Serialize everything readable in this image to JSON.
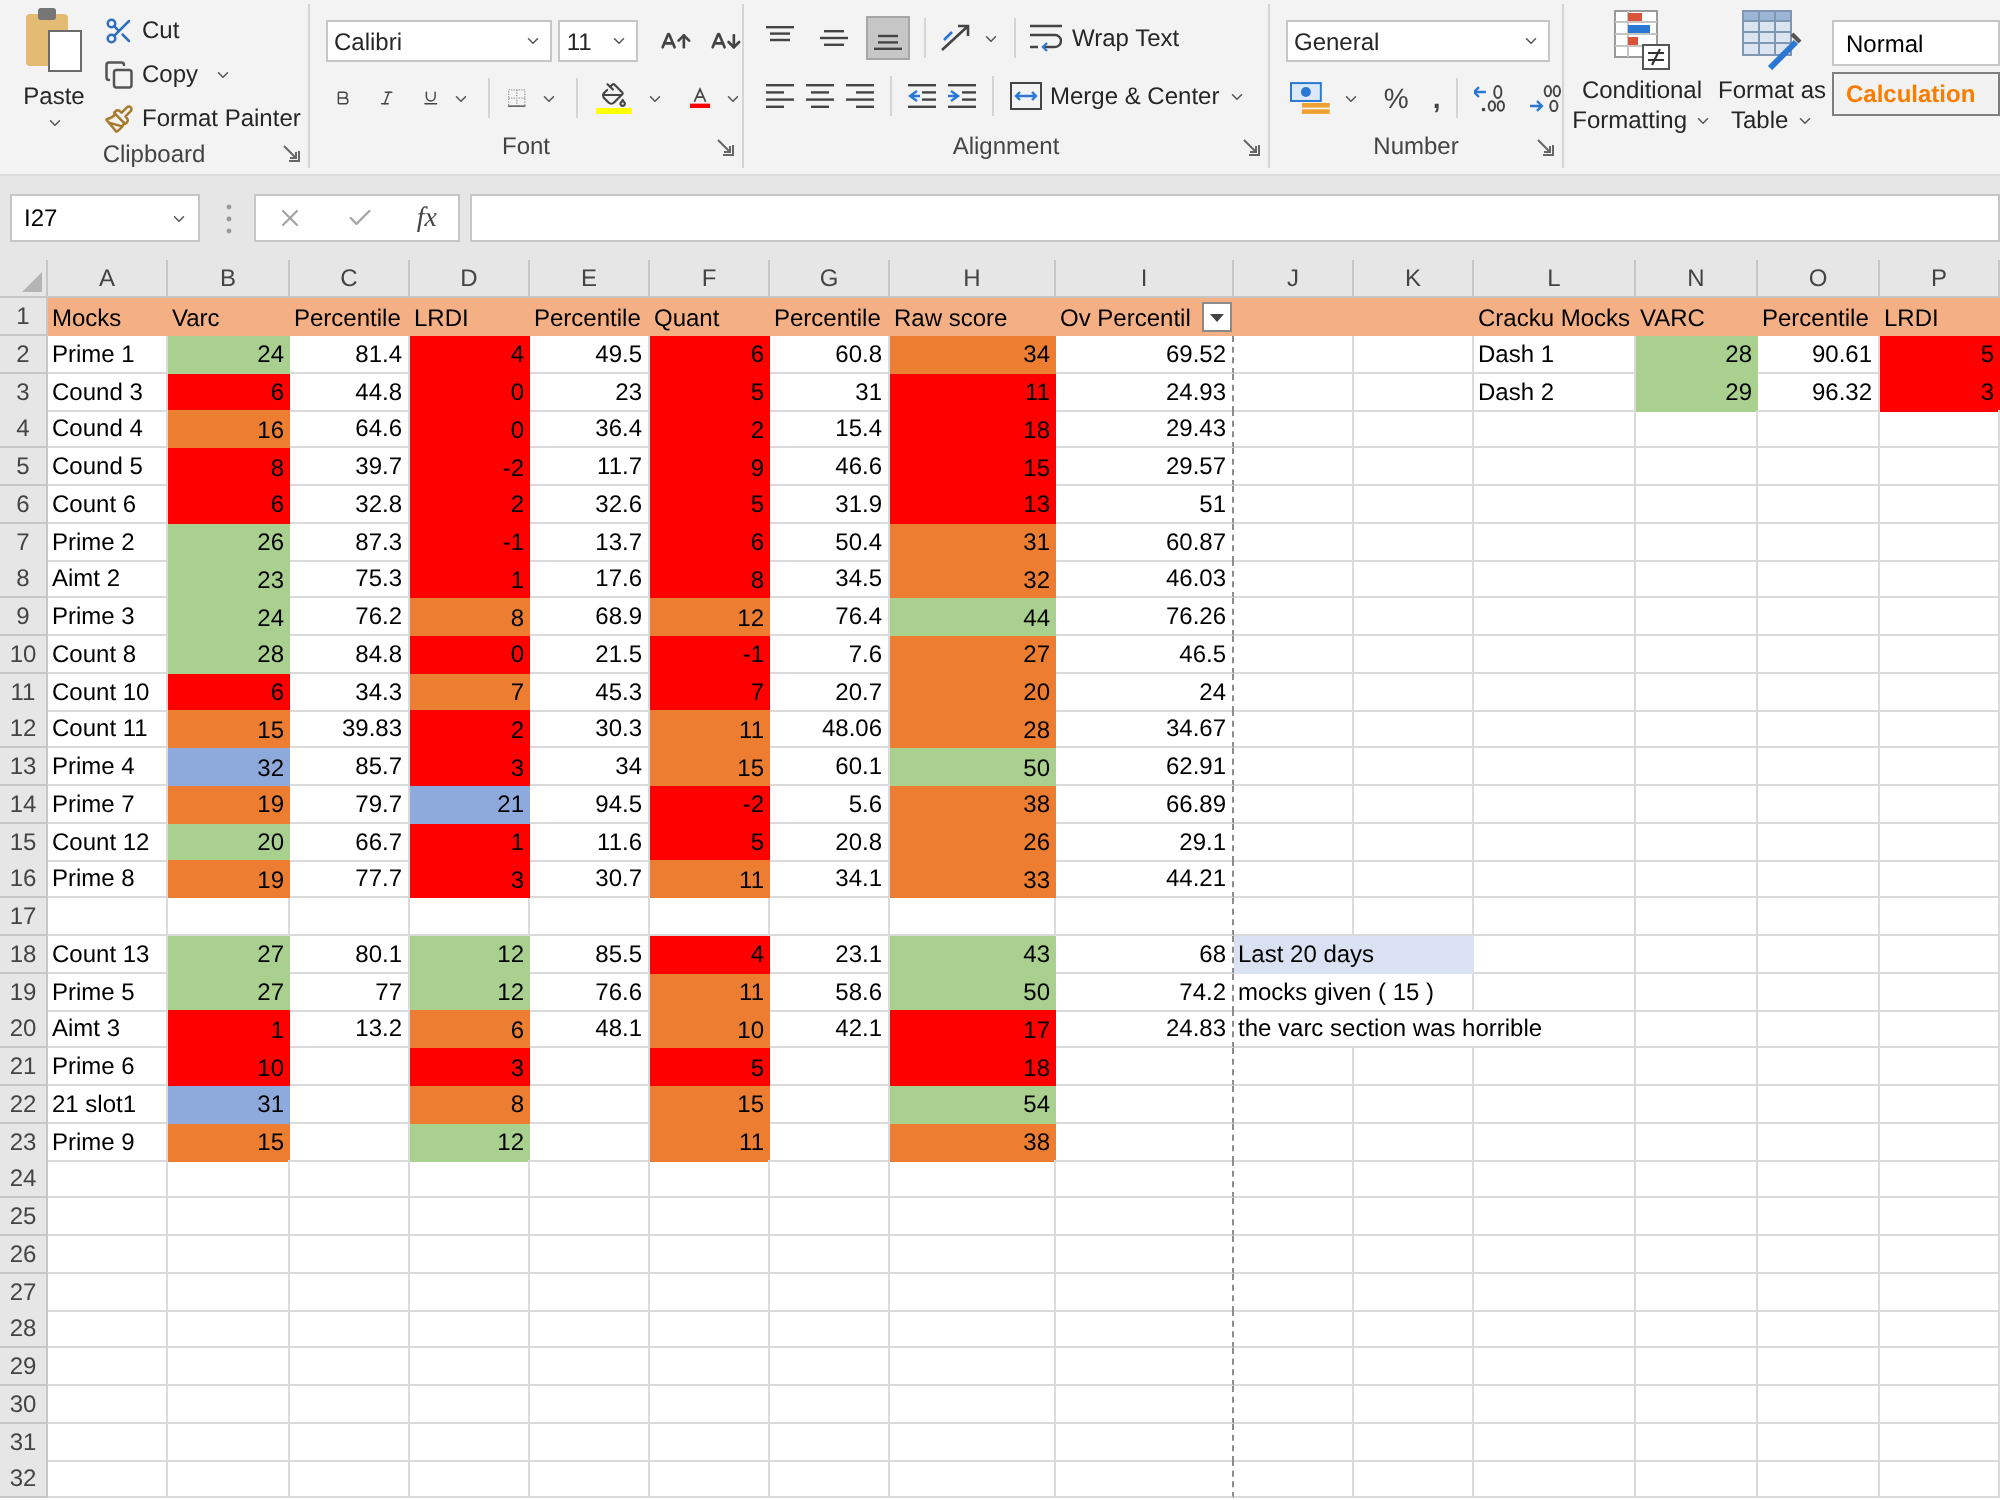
{
  "ribbon": {
    "clipboard": {
      "paste": "Paste",
      "cut": "Cut",
      "copy": "Copy",
      "format_painter": "Format Painter",
      "label": "Clipboard"
    },
    "font": {
      "font_name": "Calibri",
      "font_size": "11",
      "label": "Font"
    },
    "alignment": {
      "vertical": [
        {
          "kind": "top",
          "selected": false
        },
        {
          "kind": "middle",
          "selected": false
        },
        {
          "kind": "bottom",
          "selected": true
        }
      ],
      "wrap_text": "Wrap Text",
      "merge_center": "Merge & Center",
      "label": "Alignment"
    },
    "number": {
      "format": "General",
      "percent": "%",
      "comma": ",",
      "label": "Number"
    },
    "styles": {
      "conditional_formatting": "Conditional Formatting",
      "format_as_table": "Format as Table",
      "cell_styles": [
        {
          "kind": "normal",
          "label": "Normal"
        },
        {
          "kind": "calculation",
          "label": "Calculation"
        }
      ]
    }
  },
  "formula_bar": {
    "name_box": "I27",
    "function_label": "fx"
  },
  "sheet": {
    "columns": [
      "A",
      "B",
      "C",
      "D",
      "E",
      "F",
      "G",
      "H",
      "I",
      "J",
      "K",
      "L",
      "N",
      "O",
      "P"
    ],
    "rows": [
      {
        "number": "1",
        "cells": [
          {
            "text": "Mocks",
            "kind": "text",
            "color": "#f4b084"
          },
          {
            "text": "Varc",
            "kind": "text",
            "color": "#f4b084"
          },
          {
            "text": "Percentile",
            "kind": "text",
            "color": "#f4b084"
          },
          {
            "text": "LRDI",
            "kind": "text",
            "color": "#f4b084"
          },
          {
            "text": "Percentile",
            "kind": "text",
            "color": "#f4b084"
          },
          {
            "text": "Quant",
            "kind": "text",
            "color": "#f4b084"
          },
          {
            "text": "Percentile",
            "kind": "text",
            "color": "#f4b084"
          },
          {
            "text": "Raw score",
            "kind": "text",
            "color": "#f4b084"
          },
          {
            "text": "Ov Percentil",
            "kind": "text",
            "color": "#f4b084",
            "filter": true
          },
          {
            "color": "#f4b084"
          },
          {
            "color": "#f4b084"
          },
          {
            "text": "Cracku Mocks",
            "kind": "text",
            "color": "#f4b084"
          },
          {
            "text": "VARC",
            "kind": "text",
            "color": "#f4b084"
          },
          {
            "text": "Percentile",
            "kind": "text",
            "color": "#f4b084"
          },
          {
            "text": "LRDI",
            "kind": "text",
            "color": "#f4b084"
          }
        ]
      },
      {
        "number": "2",
        "cells": [
          {
            "text": "Prime 1",
            "kind": "text"
          },
          {
            "text": "24",
            "kind": "number",
            "color": "#a9d08e"
          },
          {
            "text": "81.4",
            "kind": "number"
          },
          {
            "text": "4",
            "kind": "number",
            "color": "#ff0000"
          },
          {
            "text": "49.5",
            "kind": "number"
          },
          {
            "text": "6",
            "kind": "number",
            "color": "#ff0000"
          },
          {
            "text": "60.8",
            "kind": "number"
          },
          {
            "text": "34",
            "kind": "number",
            "color": "#ed7d31"
          },
          {
            "text": "69.52",
            "kind": "number"
          },
          null,
          null,
          {
            "text": "Dash 1",
            "kind": "text"
          },
          {
            "text": "28",
            "kind": "number",
            "color": "#a9d08e"
          },
          {
            "text": "90.61",
            "kind": "number"
          },
          {
            "text": "5",
            "kind": "number",
            "color": "#ff0000"
          }
        ]
      },
      {
        "number": "3",
        "cells": [
          {
            "text": "Cound 3",
            "kind": "text"
          },
          {
            "text": "6",
            "kind": "number",
            "color": "#ff0000"
          },
          {
            "text": "44.8",
            "kind": "number"
          },
          {
            "text": "0",
            "kind": "number",
            "color": "#ff0000"
          },
          {
            "text": "23",
            "kind": "number"
          },
          {
            "text": "5",
            "kind": "number",
            "color": "#ff0000"
          },
          {
            "text": "31",
            "kind": "number"
          },
          {
            "text": "11",
            "kind": "number",
            "color": "#ff0000"
          },
          {
            "text": "24.93",
            "kind": "number"
          },
          null,
          null,
          {
            "text": "Dash 2",
            "kind": "text"
          },
          {
            "text": "29",
            "kind": "number",
            "color": "#a9d08e"
          },
          {
            "text": "96.32",
            "kind": "number"
          },
          {
            "text": "3",
            "kind": "number",
            "color": "#ff0000"
          }
        ]
      },
      {
        "number": "4",
        "cells": [
          {
            "text": "Cound 4",
            "kind": "text"
          },
          {
            "text": "16",
            "kind": "number",
            "color": "#ed7d31"
          },
          {
            "text": "64.6",
            "kind": "number"
          },
          {
            "text": "0",
            "kind": "number",
            "color": "#ff0000"
          },
          {
            "text": "36.4",
            "kind": "number"
          },
          {
            "text": "2",
            "kind": "number",
            "color": "#ff0000"
          },
          {
            "text": "15.4",
            "kind": "number"
          },
          {
            "text": "18",
            "kind": "number",
            "color": "#ff0000"
          },
          {
            "text": "29.43",
            "kind": "number"
          }
        ]
      },
      {
        "number": "5",
        "cells": [
          {
            "text": "Cound 5",
            "kind": "text"
          },
          {
            "text": "8",
            "kind": "number",
            "color": "#ff0000"
          },
          {
            "text": "39.7",
            "kind": "number"
          },
          {
            "text": "-2",
            "kind": "number",
            "color": "#ff0000"
          },
          {
            "text": "11.7",
            "kind": "number"
          },
          {
            "text": "9",
            "kind": "number",
            "color": "#ff0000"
          },
          {
            "text": "46.6",
            "kind": "number"
          },
          {
            "text": "15",
            "kind": "number",
            "color": "#ff0000"
          },
          {
            "text": "29.57",
            "kind": "number"
          }
        ]
      },
      {
        "number": "6",
        "cells": [
          {
            "text": "Count 6",
            "kind": "text"
          },
          {
            "text": "6",
            "kind": "number",
            "color": "#ff0000"
          },
          {
            "text": "32.8",
            "kind": "number"
          },
          {
            "text": "2",
            "kind": "number",
            "color": "#ff0000"
          },
          {
            "text": "32.6",
            "kind": "number"
          },
          {
            "text": "5",
            "kind": "number",
            "color": "#ff0000"
          },
          {
            "text": "31.9",
            "kind": "number"
          },
          {
            "text": "13",
            "kind": "number",
            "color": "#ff0000"
          },
          {
            "text": "51",
            "kind": "number"
          }
        ]
      },
      {
        "number": "7",
        "cells": [
          {
            "text": "Prime 2",
            "kind": "text"
          },
          {
            "text": "26",
            "kind": "number",
            "color": "#a9d08e"
          },
          {
            "text": "87.3",
            "kind": "number"
          },
          {
            "text": "-1",
            "kind": "number",
            "color": "#ff0000"
          },
          {
            "text": "13.7",
            "kind": "number"
          },
          {
            "text": "6",
            "kind": "number",
            "color": "#ff0000"
          },
          {
            "text": "50.4",
            "kind": "number"
          },
          {
            "text": "31",
            "kind": "number",
            "color": "#ed7d31"
          },
          {
            "text": "60.87",
            "kind": "number"
          }
        ]
      },
      {
        "number": "8",
        "cells": [
          {
            "text": "Aimt 2",
            "kind": "text"
          },
          {
            "text": "23",
            "kind": "number",
            "color": "#a9d08e"
          },
          {
            "text": "75.3",
            "kind": "number"
          },
          {
            "text": "1",
            "kind": "number",
            "color": "#ff0000"
          },
          {
            "text": "17.6",
            "kind": "number"
          },
          {
            "text": "8",
            "kind": "number",
            "color": "#ff0000"
          },
          {
            "text": "34.5",
            "kind": "number"
          },
          {
            "text": "32",
            "kind": "number",
            "color": "#ed7d31"
          },
          {
            "text": "46.03",
            "kind": "number"
          }
        ]
      },
      {
        "number": "9",
        "cells": [
          {
            "text": "Prime 3",
            "kind": "text"
          },
          {
            "text": "24",
            "kind": "number",
            "color": "#a9d08e"
          },
          {
            "text": "76.2",
            "kind": "number"
          },
          {
            "text": "8",
            "kind": "number",
            "color": "#ed7d31"
          },
          {
            "text": "68.9",
            "kind": "number"
          },
          {
            "text": "12",
            "kind": "number",
            "color": "#ed7d31"
          },
          {
            "text": "76.4",
            "kind": "number"
          },
          {
            "text": "44",
            "kind": "number",
            "color": "#a9d08e"
          },
          {
            "text": "76.26",
            "kind": "number"
          }
        ]
      },
      {
        "number": "10",
        "cells": [
          {
            "text": "Count 8",
            "kind": "text"
          },
          {
            "text": "28",
            "kind": "number",
            "color": "#a9d08e"
          },
          {
            "text": "84.8",
            "kind": "number"
          },
          {
            "text": "0",
            "kind": "number",
            "color": "#ff0000"
          },
          {
            "text": "21.5",
            "kind": "number"
          },
          {
            "text": "-1",
            "kind": "number",
            "color": "#ff0000"
          },
          {
            "text": "7.6",
            "kind": "number"
          },
          {
            "text": "27",
            "kind": "number",
            "color": "#ed7d31"
          },
          {
            "text": "46.5",
            "kind": "number"
          }
        ]
      },
      {
        "number": "11",
        "cells": [
          {
            "text": "Count 10",
            "kind": "text"
          },
          {
            "text": "6",
            "kind": "number",
            "color": "#ff0000"
          },
          {
            "text": "34.3",
            "kind": "number"
          },
          {
            "text": "7",
            "kind": "number",
            "color": "#ed7d31"
          },
          {
            "text": "45.3",
            "kind": "number"
          },
          {
            "text": "7",
            "kind": "number",
            "color": "#ff0000"
          },
          {
            "text": "20.7",
            "kind": "number"
          },
          {
            "text": "20",
            "kind": "number",
            "color": "#ed7d31"
          },
          {
            "text": "24",
            "kind": "number"
          }
        ]
      },
      {
        "number": "12",
        "cells": [
          {
            "text": "Count 11",
            "kind": "text"
          },
          {
            "text": "15",
            "kind": "number",
            "color": "#ed7d31"
          },
          {
            "text": "39.83",
            "kind": "number"
          },
          {
            "text": "2",
            "kind": "number",
            "color": "#ff0000"
          },
          {
            "text": "30.3",
            "kind": "number"
          },
          {
            "text": "11",
            "kind": "number",
            "color": "#ed7d31"
          },
          {
            "text": "48.06",
            "kind": "number"
          },
          {
            "text": "28",
            "kind": "number",
            "color": "#ed7d31"
          },
          {
            "text": "34.67",
            "kind": "number"
          }
        ]
      },
      {
        "number": "13",
        "cells": [
          {
            "text": "Prime 4",
            "kind": "text"
          },
          {
            "text": "32",
            "kind": "number",
            "color": "#8ea9db"
          },
          {
            "text": "85.7",
            "kind": "number"
          },
          {
            "text": "3",
            "kind": "number",
            "color": "#ff0000"
          },
          {
            "text": "34",
            "kind": "number"
          },
          {
            "text": "15",
            "kind": "number",
            "color": "#ed7d31"
          },
          {
            "text": "60.1",
            "kind": "number"
          },
          {
            "text": "50",
            "kind": "number",
            "color": "#a9d08e"
          },
          {
            "text": "62.91",
            "kind": "number"
          }
        ]
      },
      {
        "number": "14",
        "cells": [
          {
            "text": "Prime 7",
            "kind": "text"
          },
          {
            "text": "19",
            "kind": "number",
            "color": "#ed7d31"
          },
          {
            "text": "79.7",
            "kind": "number"
          },
          {
            "text": "21",
            "kind": "number",
            "color": "#8ea9db"
          },
          {
            "text": "94.5",
            "kind": "number"
          },
          {
            "text": "-2",
            "kind": "number",
            "color": "#ff0000"
          },
          {
            "text": "5.6",
            "kind": "number"
          },
          {
            "text": "38",
            "kind": "number",
            "color": "#ed7d31"
          },
          {
            "text": "66.89",
            "kind": "number"
          }
        ]
      },
      {
        "number": "15",
        "cells": [
          {
            "text": "Count 12",
            "kind": "text"
          },
          {
            "text": "20",
            "kind": "number",
            "color": "#a9d08e"
          },
          {
            "text": "66.7",
            "kind": "number"
          },
          {
            "text": "1",
            "kind": "number",
            "color": "#ff0000"
          },
          {
            "text": "11.6",
            "kind": "number"
          },
          {
            "text": "5",
            "kind": "number",
            "color": "#ff0000"
          },
          {
            "text": "20.8",
            "kind": "number"
          },
          {
            "text": "26",
            "kind": "number",
            "color": "#ed7d31"
          },
          {
            "text": "29.1",
            "kind": "number"
          }
        ]
      },
      {
        "number": "16",
        "cells": [
          {
            "text": "Prime 8",
            "kind": "text"
          },
          {
            "text": "19",
            "kind": "number",
            "color": "#ed7d31"
          },
          {
            "text": "77.7",
            "kind": "number"
          },
          {
            "text": "3",
            "kind": "number",
            "color": "#ff0000"
          },
          {
            "text": "30.7",
            "kind": "number"
          },
          {
            "text": "11",
            "kind": "number",
            "color": "#ed7d31"
          },
          {
            "text": "34.1",
            "kind": "number"
          },
          {
            "text": "33",
            "kind": "number",
            "color": "#ed7d31"
          },
          {
            "text": "44.21",
            "kind": "number"
          }
        ]
      },
      {
        "number": "17"
      },
      {
        "number": "18",
        "cells": [
          {
            "text": "Count 13",
            "kind": "text"
          },
          {
            "text": "27",
            "kind": "number",
            "color": "#a9d08e"
          },
          {
            "text": "80.1",
            "kind": "number"
          },
          {
            "text": "12",
            "kind": "number",
            "color": "#a9d08e"
          },
          {
            "text": "85.5",
            "kind": "number"
          },
          {
            "text": "4",
            "kind": "number",
            "color": "#ff0000"
          },
          {
            "text": "23.1",
            "kind": "number"
          },
          {
            "text": "43",
            "kind": "number",
            "color": "#a9d08e"
          },
          {
            "text": "68",
            "kind": "number"
          },
          {
            "text": "Last 20 days",
            "kind": "text",
            "color": "#d9e1f2"
          }
        ]
      },
      {
        "number": "19",
        "cells": [
          {
            "text": "Prime 5",
            "kind": "text"
          },
          {
            "text": "27",
            "kind": "number",
            "color": "#a9d08e"
          },
          {
            "text": "77",
            "kind": "number"
          },
          {
            "text": "12",
            "kind": "number",
            "color": "#a9d08e"
          },
          {
            "text": "76.6",
            "kind": "number"
          },
          {
            "text": "11",
            "kind": "number",
            "color": "#ed7d31"
          },
          {
            "text": "58.6",
            "kind": "number"
          },
          {
            "text": "50",
            "kind": "number",
            "color": "#a9d08e"
          },
          {
            "text": "74.2",
            "kind": "number"
          },
          {
            "text": "mocks given ( 15 )",
            "kind": "text"
          }
        ]
      },
      {
        "number": "20",
        "cells": [
          {
            "text": "Aimt 3",
            "kind": "text"
          },
          {
            "text": "1",
            "kind": "number",
            "color": "#ff0000"
          },
          {
            "text": "13.2",
            "kind": "number"
          },
          {
            "text": "6",
            "kind": "number",
            "color": "#ed7d31"
          },
          {
            "text": "48.1",
            "kind": "number"
          },
          {
            "text": "10",
            "kind": "number",
            "color": "#ed7d31"
          },
          {
            "text": "42.1",
            "kind": "number"
          },
          {
            "text": "17",
            "kind": "number",
            "color": "#ff0000"
          },
          {
            "text": "24.83",
            "kind": "number"
          },
          {
            "text": "the varc section was horrible",
            "kind": "text"
          }
        ]
      },
      {
        "number": "21",
        "cells": [
          {
            "text": "Prime 6",
            "kind": "text"
          },
          {
            "text": "10",
            "kind": "number",
            "color": "#ff0000"
          },
          null,
          {
            "text": "3",
            "kind": "number",
            "color": "#ff0000"
          },
          null,
          {
            "text": "5",
            "kind": "number",
            "color": "#ff0000"
          },
          null,
          {
            "text": "18",
            "kind": "number",
            "color": "#ff0000"
          }
        ]
      },
      {
        "number": "22",
        "cells": [
          {
            "text": "21 slot1",
            "kind": "text"
          },
          {
            "text": "31",
            "kind": "number",
            "color": "#8ea9db"
          },
          null,
          {
            "text": "8",
            "kind": "number",
            "color": "#ed7d31"
          },
          null,
          {
            "text": "15",
            "kind": "number",
            "color": "#ed7d31"
          },
          null,
          {
            "text": "54",
            "kind": "number",
            "color": "#a9d08e"
          }
        ]
      },
      {
        "number": "23",
        "cells": [
          {
            "text": "Prime 9",
            "kind": "text"
          },
          {
            "text": "15",
            "kind": "number",
            "color": "#ed7d31"
          },
          null,
          {
            "text": "12",
            "kind": "number",
            "color": "#a9d08e"
          },
          null,
          {
            "text": "11",
            "kind": "number",
            "color": "#ed7d31"
          },
          null,
          {
            "text": "38",
            "kind": "number",
            "color": "#ed7d31"
          }
        ]
      },
      {
        "number": "24"
      },
      {
        "number": "25"
      },
      {
        "number": "26"
      },
      {
        "number": "27"
      },
      {
        "number": "28"
      },
      {
        "number": "29"
      },
      {
        "number": "30"
      },
      {
        "number": "31"
      },
      {
        "number": "32"
      }
    ]
  }
}
